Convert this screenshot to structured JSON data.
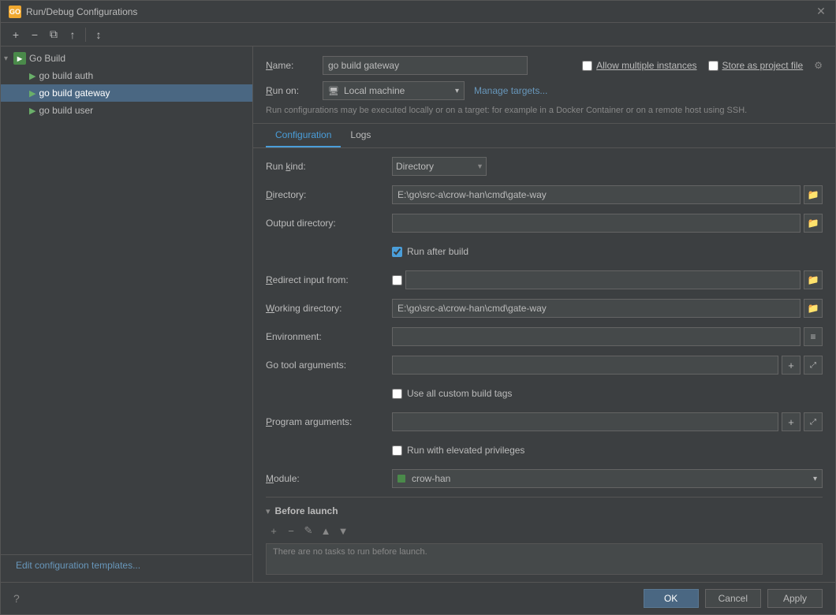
{
  "dialog": {
    "title": "Run/Debug Configurations",
    "icon_text": "GO"
  },
  "toolbar": {
    "add_label": "+",
    "remove_label": "−",
    "copy_label": "⧉",
    "move_up_label": "↑",
    "sort_label": "↕"
  },
  "sidebar": {
    "group_label": "Go Build",
    "items": [
      {
        "label": "go build auth",
        "selected": false
      },
      {
        "label": "go build gateway",
        "selected": true
      },
      {
        "label": "go build user",
        "selected": false
      }
    ],
    "footer_link": "Edit configuration templates..."
  },
  "header": {
    "name_label": "Name:",
    "name_value": "go build gateway",
    "allow_multiple_label": "Allow multiple instances",
    "store_as_project_label": "Store as project file",
    "run_on_label": "Run on:",
    "local_machine_label": "Local machine",
    "manage_targets_label": "Manage targets...",
    "info_text": "Run configurations may be executed locally or on a target: for example in a Docker Container or on a remote host using SSH."
  },
  "tabs": {
    "configuration_label": "Configuration",
    "logs_label": "Logs",
    "active": "Configuration"
  },
  "form": {
    "run_kind_label": "Run kind:",
    "run_kind_value": "Directory",
    "directory_label": "Directory:",
    "directory_value": "E:\\go\\src-a\\crow-han\\cmd\\gate-way",
    "output_dir_label": "Output directory:",
    "output_dir_value": "",
    "run_after_build_label": "Run after build",
    "run_after_build_checked": true,
    "redirect_input_label": "Redirect input from:",
    "redirect_input_checked": false,
    "redirect_input_value": "",
    "working_dir_label": "Working directory:",
    "working_dir_value": "E:\\go\\src-a\\crow-han\\cmd\\gate-way",
    "environment_label": "Environment:",
    "environment_value": "",
    "go_tool_args_label": "Go tool arguments:",
    "go_tool_args_value": "",
    "use_custom_build_tags_label": "Use all custom build tags",
    "use_custom_build_tags_checked": false,
    "program_args_label": "Program arguments:",
    "program_args_value": "",
    "run_elevated_label": "Run with elevated privileges",
    "run_elevated_checked": false,
    "module_label": "Module:",
    "module_value": "crow-han"
  },
  "before_launch": {
    "section_label": "Before launch",
    "empty_text": "There are no tasks to run before launch.",
    "toolbar": {
      "add": "+",
      "remove": "−",
      "edit": "✎",
      "move_up": "▲",
      "move_down": "▼"
    }
  },
  "footer": {
    "ok_label": "OK",
    "cancel_label": "Cancel",
    "apply_label": "Apply"
  }
}
